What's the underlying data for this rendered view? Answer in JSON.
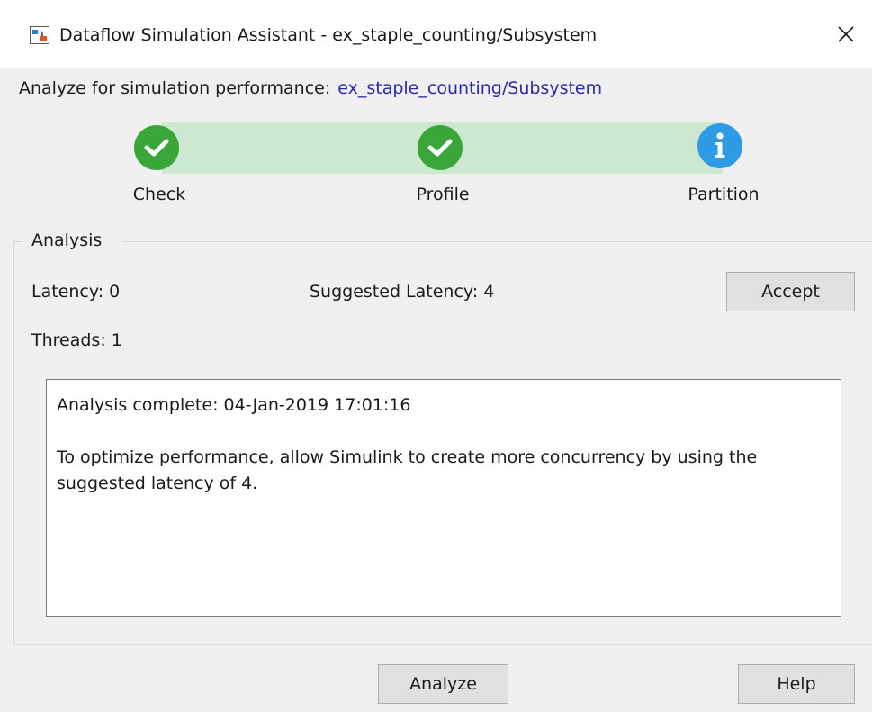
{
  "window": {
    "title": "Dataflow Simulation Assistant - ex_staple_counting/Subsystem",
    "close_glyph": "✕"
  },
  "analyze_for": {
    "label": "Analyze for simulation performance:",
    "link": "ex_staple_counting/Subsystem"
  },
  "steps": [
    {
      "label": "Check",
      "status": "complete",
      "icon": "check-icon",
      "color": "#3aa63a"
    },
    {
      "label": "Profile",
      "status": "complete",
      "icon": "check-icon",
      "color": "#3aa63a"
    },
    {
      "label": "Partition",
      "status": "info",
      "icon": "info-icon",
      "color": "#2e9be6",
      "glyph": "i"
    }
  ],
  "analysis": {
    "group_title": "Analysis",
    "latency": "Latency: 0",
    "suggested_latency": "Suggested Latency: 4",
    "threads": "Threads: 1",
    "accept_label": "Accept",
    "message_line1": "Analysis complete: 04-Jan-2019 17:01:16",
    "message_line2": "To optimize performance, allow Simulink to create more concurrency by using the suggested latency of 4."
  },
  "footer": {
    "analyze_label": "Analyze",
    "help_label": "Help"
  },
  "colors": {
    "progress_band": "#cde8d1",
    "link": "#2a2aa6"
  }
}
